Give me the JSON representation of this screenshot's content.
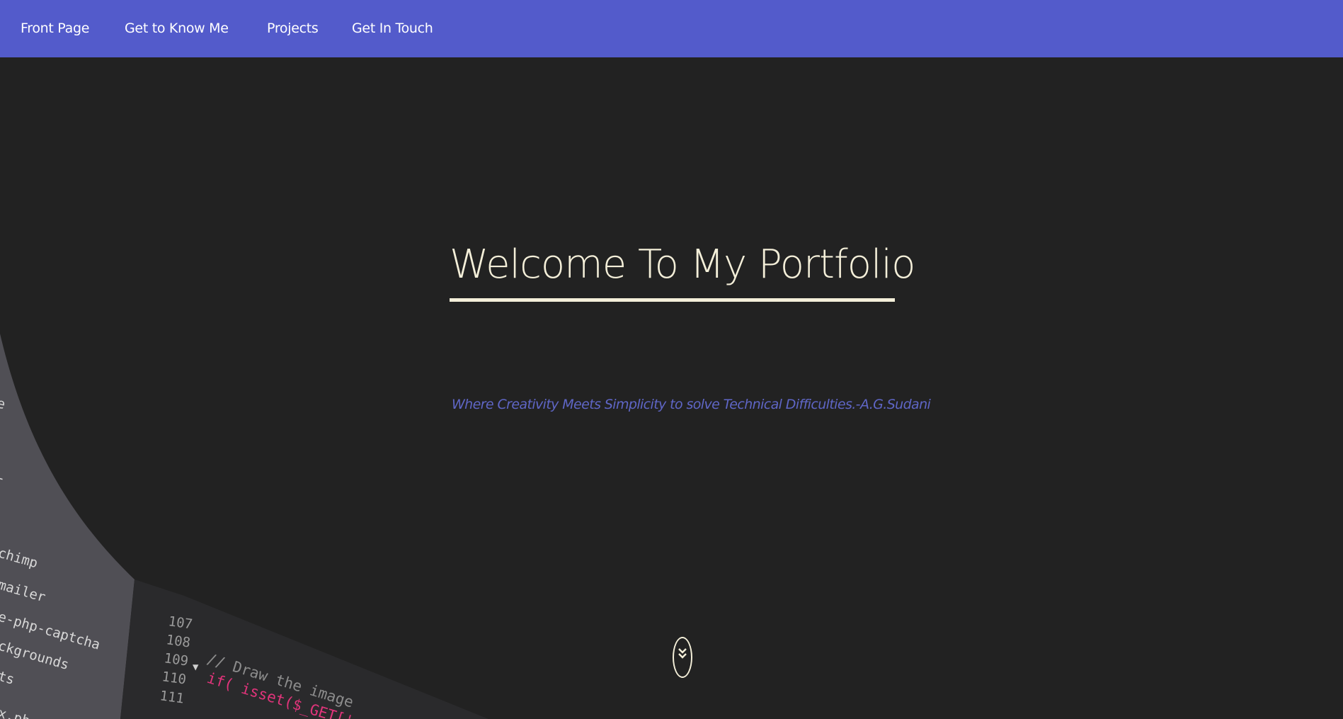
{
  "nav": {
    "items": [
      {
        "label": "Front Page"
      },
      {
        "label": "Get to Know Me"
      },
      {
        "label": "Projects"
      },
      {
        "label": "Get In Touch"
      }
    ]
  },
  "hero": {
    "title": "Welcome To My Portfolio",
    "tagline": "Where Creativity Meets Simplicity to solve Technical Difficulties.-A.G.Sudani",
    "scroll_icon": "double-chevron-down-icon"
  },
  "background": {
    "sidebar_items": [
      "e",
      "-",
      "chimp",
      "mailer",
      "e-php-captcha",
      "ckgrounds",
      "ts",
      "x.php"
    ],
    "line_numbers": [
      "107",
      "108",
      "109",
      "110",
      "111"
    ],
    "code_lines": [
      "// Draw the image",
      "if( isset($_GET['"
    ]
  },
  "colors": {
    "nav_bg": "#535bcb",
    "page_bg": "#222222",
    "title": "#f4efd9",
    "tagline": "#5f66c6"
  }
}
